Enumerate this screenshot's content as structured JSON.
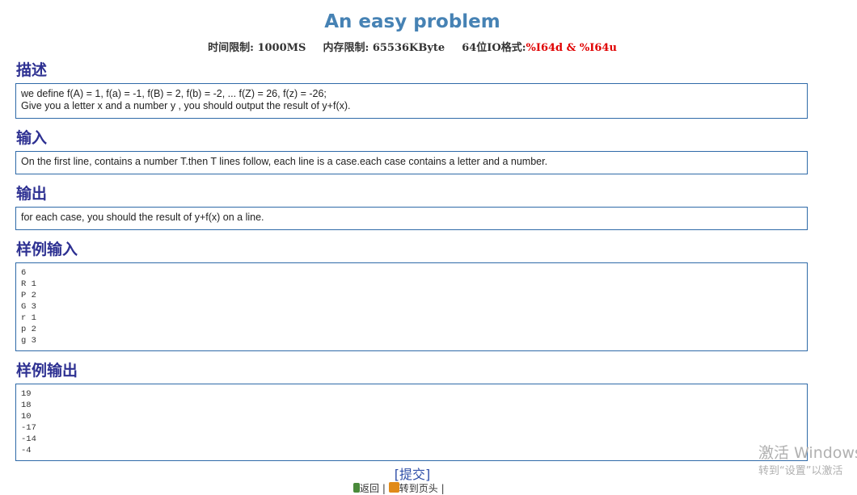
{
  "problem": {
    "title": "An easy problem",
    "time_limit_label": "时间限制:",
    "time_limit_value": "1000MS",
    "memory_limit_label": "内存限制:",
    "memory_limit_value": "65536KByte",
    "io_label": "64位IO格式:",
    "io_value": "%I64d & %I64u"
  },
  "sections": {
    "description": {
      "heading": "描述",
      "line1": "we define f(A) = 1, f(a) = -1, f(B) = 2, f(b) = -2, ... f(Z) = 26, f(z) = -26;",
      "line2": "Give you a letter x and a number y , you should output the result of y+f(x)."
    },
    "input": {
      "heading": "输入",
      "text": "On the first line, contains a number T.then T lines follow, each line is a case.each case contains a letter and a number."
    },
    "output": {
      "heading": "输出",
      "text": "for each case, you should the result of y+f(x) on a line."
    },
    "sample_input": {
      "heading": "样例输入",
      "text": "6\nR 1\nP 2\nG 3\nr 1\np 2\ng 3"
    },
    "sample_output": {
      "heading": "样例输出",
      "text": "19\n18\n10\n-17\n-14\n-4"
    }
  },
  "actions": {
    "submit_label": "提交",
    "back_label": "返回",
    "top_label": "转到页头",
    "separator": "|"
  },
  "watermark": {
    "line1": "激活 Windows",
    "line2": "转到“设置”以激活"
  }
}
